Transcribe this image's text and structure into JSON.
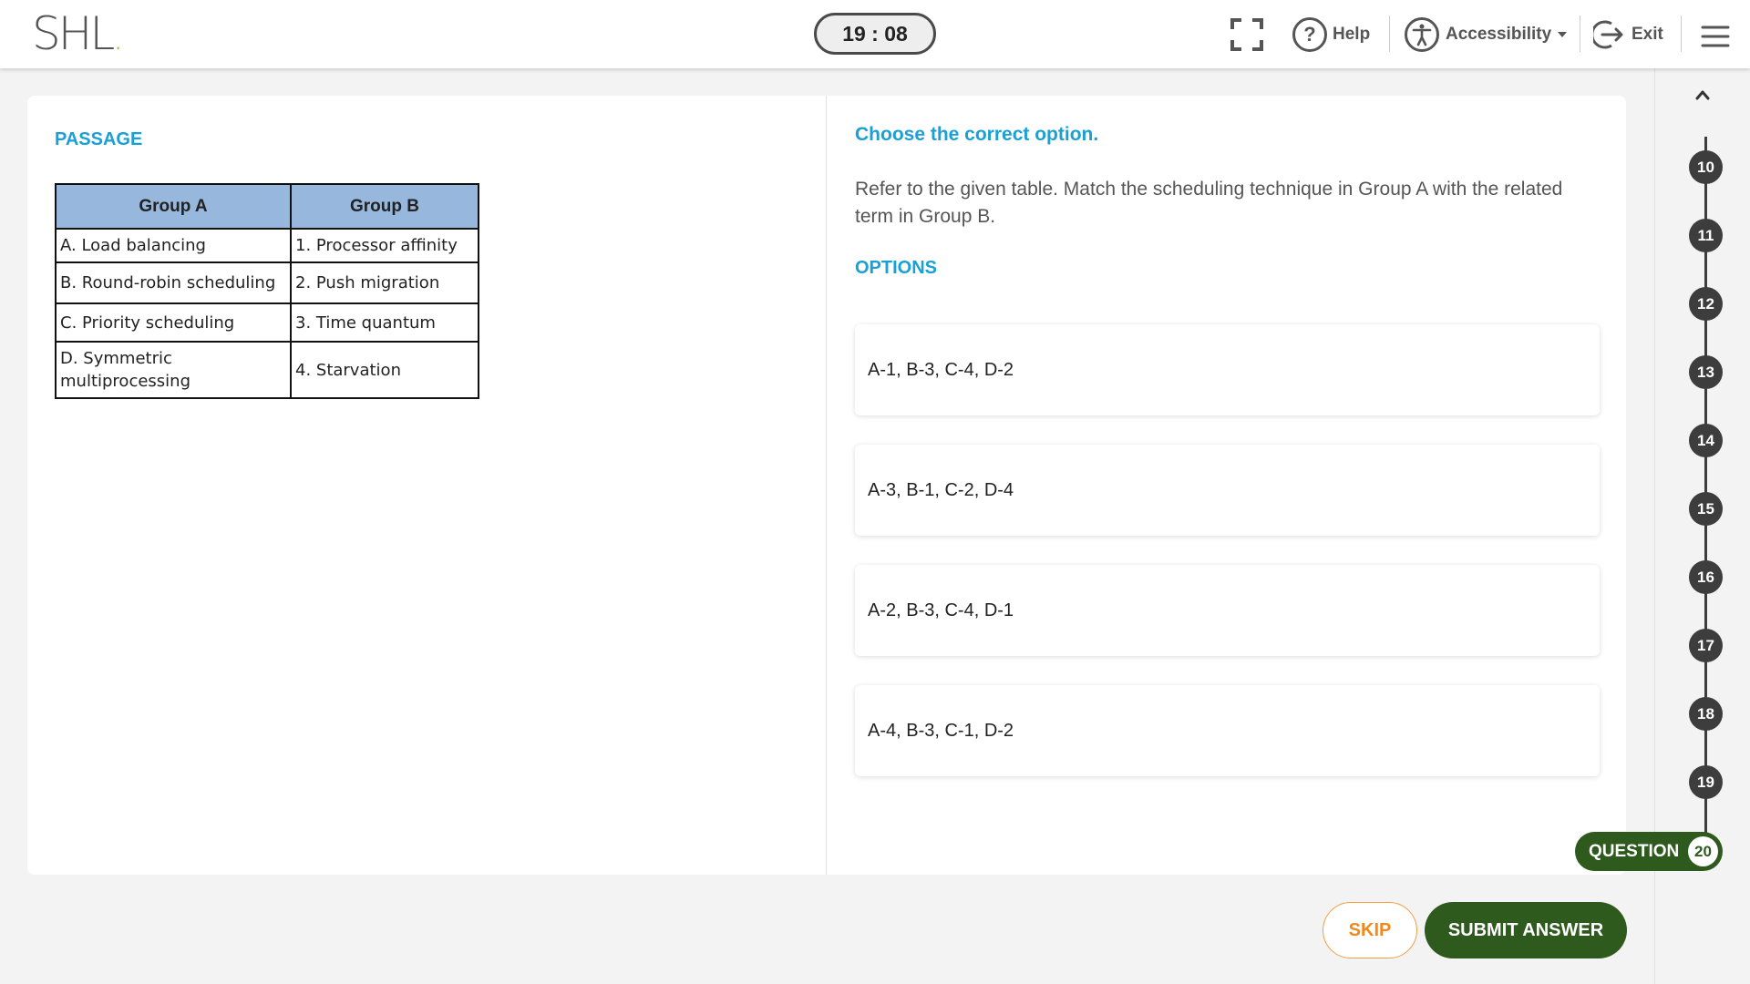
{
  "header": {
    "logo_text": "SHL",
    "logo_dot": ".",
    "timer": "19 : 08",
    "help_label": "Help",
    "accessibility_label": "Accessibility",
    "exit_label": "Exit"
  },
  "passage": {
    "title": "PASSAGE",
    "table": {
      "headers": [
        "Group A",
        "Group B"
      ],
      "rows": [
        [
          "A. Load balancing",
          "1. Processor affinity"
        ],
        [
          "B. Round-robin scheduling",
          "2. Push migration"
        ],
        [
          "C. Priority scheduling",
          "3. Time quantum"
        ],
        [
          "D. Symmetric multiprocessing",
          "4. Starvation"
        ]
      ]
    }
  },
  "question": {
    "instruction": "Choose the correct option.",
    "text": "Refer to the given table. Match the scheduling technique in Group A with the related term in Group B.",
    "options_title": "OPTIONS",
    "options": [
      "A-1, B-3, C-4, D-2",
      "A-3, B-1, C-2, D-4",
      "A-2, B-3, C-4, D-1",
      "A-4, B-3, C-1, D-2"
    ]
  },
  "navigation": {
    "questions": [
      "10",
      "11",
      "12",
      "13",
      "14",
      "15",
      "16",
      "17",
      "18",
      "19"
    ],
    "current_label": "QUESTION",
    "current_number": "20"
  },
  "footer": {
    "skip_label": "SKIP",
    "submit_label": "SUBMIT ANSWER"
  },
  "colors": {
    "accent_blue": "#1aa0d5",
    "brand_green": "#2e5a1e",
    "skip_orange": "#f08a1c",
    "table_header": "#97b8dc"
  }
}
